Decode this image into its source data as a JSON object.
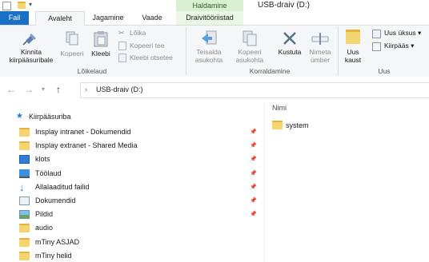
{
  "window": {
    "title": "USB-draiv (D:)",
    "context_tab_header": "Haldamine"
  },
  "tabs": [
    "Fail",
    "Avaleht",
    "Jagamine",
    "Vaade",
    "Draivitööriistad"
  ],
  "ribbon": {
    "clipboard": {
      "pin_label": "Kinnita kiirpääsuribale",
      "copy_label": "Kopeeri",
      "paste_label": "Kleebi",
      "cut_label": "Lõika",
      "copy_path_label": "Kopeeri tee",
      "paste_shortcut_label": "Kleebi otsetee",
      "group_label": "Lõikelaud"
    },
    "organize": {
      "move_to_label": "Teisalda asukohta",
      "copy_to_label": "Kopeeri asukohta",
      "delete_label": "Kustuta",
      "rename_label": "Nimeta ümber",
      "group_label": "Korraldamine"
    },
    "new": {
      "new_folder_label": "Uus kaust",
      "new_item_label": "Uus üksus",
      "easy_access_label": "Kiirpääs",
      "group_label": "Uus"
    }
  },
  "address": {
    "path": "USB-draiv (D:)"
  },
  "nav": {
    "quick_access": "Kiirpääsuriba",
    "items": [
      {
        "label": "Insplay intranet - Dokumendid",
        "icon": "folder-icon",
        "pinned": true
      },
      {
        "label": "Insplay extranet - Shared Media",
        "icon": "folder-icon",
        "pinned": true
      },
      {
        "label": "klots",
        "icon": "screen-icon",
        "pinned": true
      },
      {
        "label": "Töölaud",
        "icon": "desktop-icon",
        "pinned": true
      },
      {
        "label": "Allalaaditud failid",
        "icon": "download-icon",
        "pinned": true
      },
      {
        "label": "Dokumendid",
        "icon": "documents-icon",
        "pinned": true
      },
      {
        "label": "Pildid",
        "icon": "pictures-icon",
        "pinned": true
      },
      {
        "label": "audio",
        "icon": "folder-icon",
        "pinned": false
      },
      {
        "label": "mTiny ASJAD",
        "icon": "folder-icon",
        "pinned": false
      },
      {
        "label": "mTiny helid",
        "icon": "folder-icon",
        "pinned": false
      }
    ]
  },
  "content": {
    "column_name": "Nimi",
    "files": [
      {
        "name": "system",
        "icon": "folder-icon"
      }
    ]
  }
}
